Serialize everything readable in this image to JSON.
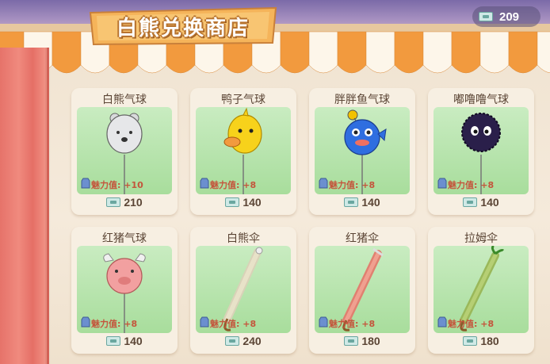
{
  "shop": {
    "title": "白熊兑换商店"
  },
  "currency": {
    "icon": "ticket-icon",
    "amount": "209"
  },
  "charm_label": "魅力值:",
  "items": [
    {
      "name": "白熊气球",
      "charm": "+10",
      "price": "210",
      "kind": "bear-balloon-icon"
    },
    {
      "name": "鸭子气球",
      "charm": "+8",
      "price": "140",
      "kind": "duck-balloon-icon"
    },
    {
      "name": "胖胖鱼气球",
      "charm": "+8",
      "price": "140",
      "kind": "fish-balloon-icon"
    },
    {
      "name": "嘟噜噜气球",
      "charm": "+8",
      "price": "140",
      "kind": "fuzzball-balloon-icon"
    },
    {
      "name": "红猪气球",
      "charm": "+8",
      "price": "140",
      "kind": "pig-balloon-icon"
    },
    {
      "name": "白熊伞",
      "charm": "+8",
      "price": "240",
      "kind": "bear-umbrella-icon"
    },
    {
      "name": "红猪伞",
      "charm": "+8",
      "price": "180",
      "kind": "pig-umbrella-icon"
    },
    {
      "name": "拉姆伞",
      "charm": "+8",
      "price": "180",
      "kind": "lamb-umbrella-icon"
    }
  ],
  "colors": {
    "awning_orange": "#f29a3e",
    "awning_white": "#fdf6ea",
    "card_bg": "#c9ecc1",
    "charm_text": "#c4553c"
  }
}
